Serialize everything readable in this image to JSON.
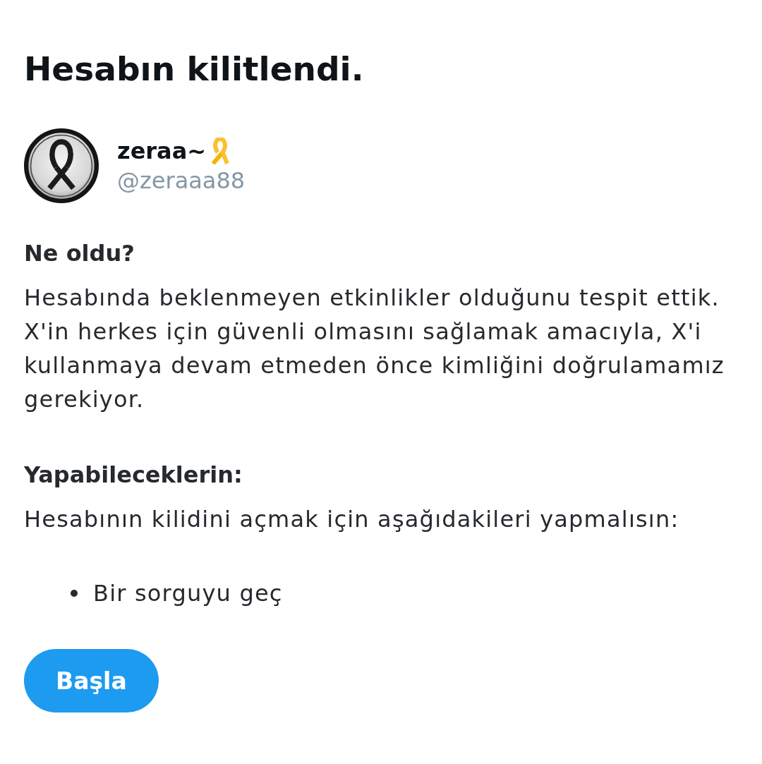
{
  "title": "Hesabın kilitlendi.",
  "account": {
    "display_name": "zeraa~",
    "handle": "@zeraaa88"
  },
  "sections": [
    {
      "heading": "Ne oldu?",
      "lines": [
        "Hesabında beklenmeyen etkinlikler olduğunu tespit ettik.",
        "X'in herkes için güvenli olmasını sağlamak amacıyla, X'i",
        "kullanmaya devam etmeden önce kimliğini doğrulamamız",
        "gerekiyor."
      ]
    },
    {
      "heading": "Yapabileceklerin:",
      "lines": [
        "Hesabının kilidini açmak için aşağıdakileri yapmalısın:"
      ],
      "items": [
        "Bir sorguyu geç"
      ]
    }
  ],
  "button": {
    "label": "Başla"
  }
}
